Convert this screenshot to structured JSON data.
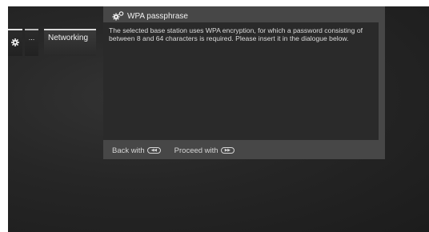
{
  "breadcrumb": {
    "settings_icon": "gear-icon",
    "ellipsis_label": "...",
    "networking_label": "Networking"
  },
  "dialog": {
    "title": "WPA passphrase",
    "title_icon": "gears-icon",
    "body_text": "The selected base station uses WPA encryption, for which a password consisting of between 8 and 64 characters is required. Please insert it in the dialogue below."
  },
  "footer": {
    "back_label": "Back with",
    "back_key_glyph": "◀◀",
    "proceed_label": "Proceed with",
    "proceed_key_glyph": "▶▶"
  },
  "colors": {
    "background": "#262626",
    "dialog_frame": "#474747",
    "dialog_body": "#2a2a2a",
    "text": "#dcdcdc"
  }
}
